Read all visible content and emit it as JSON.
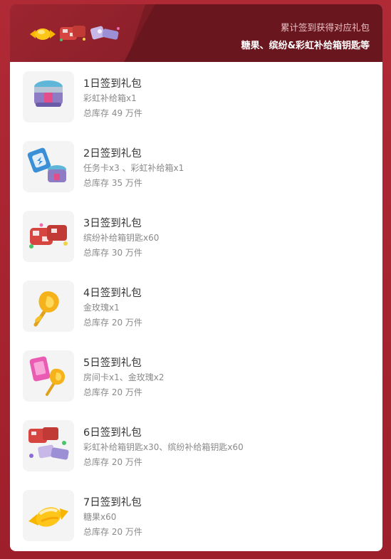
{
  "header": {
    "line1": "累计签到获得对应礼包",
    "line2": "糖果、缤纷&彩虹补给箱钥匙等"
  },
  "items": [
    {
      "title": "1日签到礼包",
      "desc": "彩虹补给箱x1",
      "stock": "总库存 49 万件",
      "icon": "rainbow-chest-icon"
    },
    {
      "title": "2日签到礼包",
      "desc": "任务卡x3 、彩虹补给箱x1",
      "stock": "总库存 35 万件",
      "icon": "task-card-chest-icon"
    },
    {
      "title": "3日签到礼包",
      "desc": "缤纷补给箱钥匙x60",
      "stock": "总库存 30 万件",
      "icon": "colorful-keys-icon"
    },
    {
      "title": "4日签到礼包",
      "desc": "金玫瑰x1",
      "stock": "总库存 20 万件",
      "icon": "gold-rose-icon"
    },
    {
      "title": "5日签到礼包",
      "desc": "房间卡x1、金玫瑰x2",
      "stock": "总库存 20 万件",
      "icon": "room-card-rose-icon"
    },
    {
      "title": "6日签到礼包",
      "desc": "彩虹补给箱钥匙x30、缤纷补给箱钥匙x60",
      "stock": "总库存 20 万件",
      "icon": "mixed-keys-icon"
    },
    {
      "title": "7日签到礼包",
      "desc": "糖果x60",
      "stock": "总库存 20 万件",
      "icon": "candy-icon"
    }
  ],
  "colors": {
    "background": "#a8232f",
    "header": "#7a1a22",
    "card": "#ffffff",
    "thumb_bg": "#f4f4f4"
  }
}
